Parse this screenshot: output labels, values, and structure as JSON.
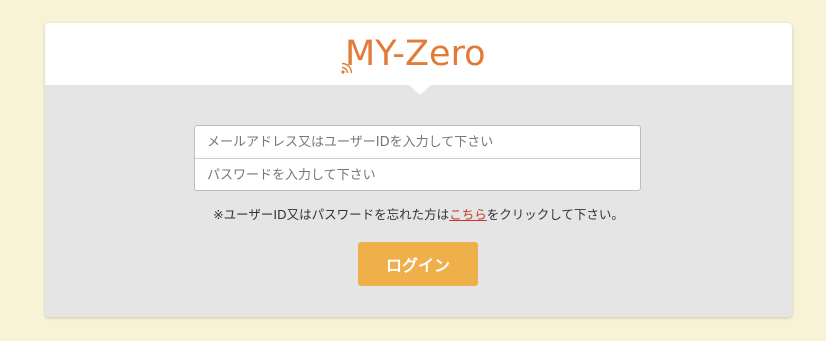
{
  "logo": {
    "text": "MY-Zero",
    "color": "#e37b38"
  },
  "form": {
    "id_placeholder": "メールアドレス又はユーザーIDを入力して下さい",
    "password_placeholder": "パスワードを入力して下さい"
  },
  "note": {
    "prefix": "※ユーザーID又はパスワードを忘れた方は",
    "link_text": "こちら",
    "suffix": "をクリックして下さい。"
  },
  "login_button": {
    "label": "ログイン",
    "color": "#efaf4a"
  }
}
